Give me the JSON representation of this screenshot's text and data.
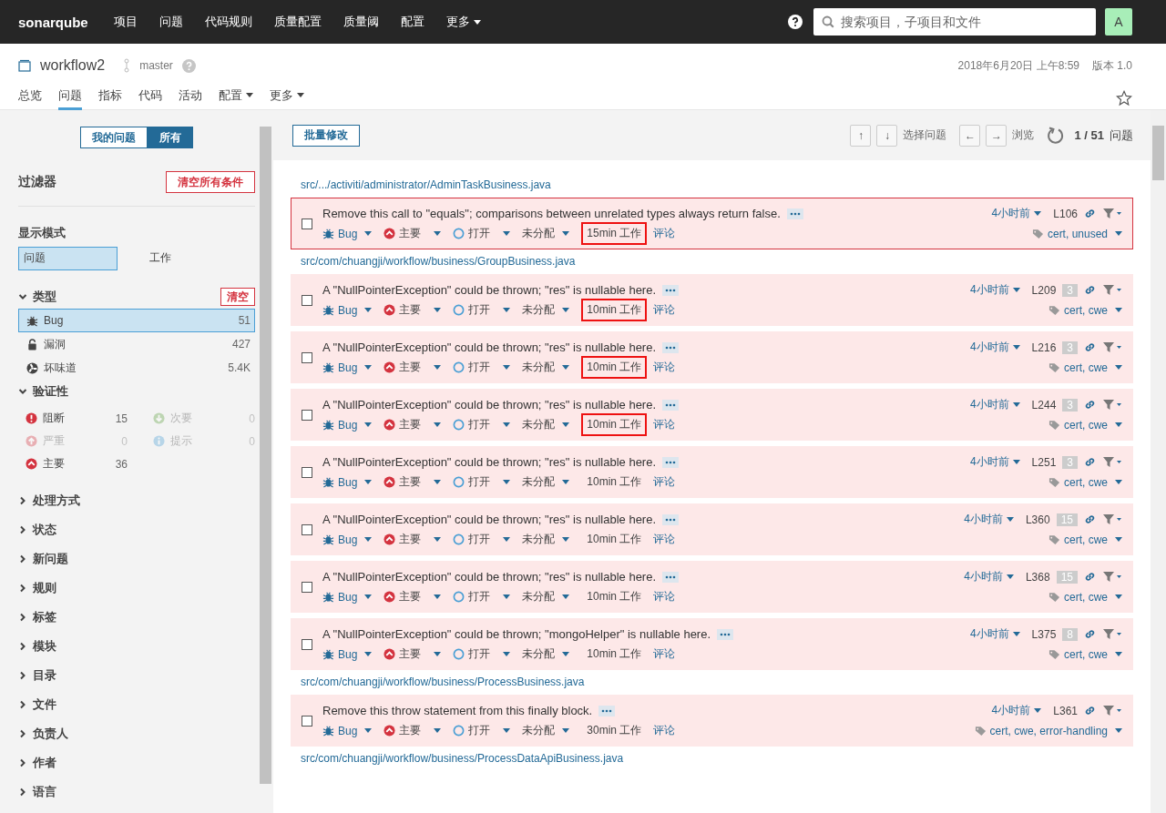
{
  "navbar": {
    "logo": "sonarqube",
    "items": [
      {
        "label": "项目",
        "dropdown": false
      },
      {
        "label": "问题",
        "dropdown": false
      },
      {
        "label": "代码规则",
        "dropdown": false
      },
      {
        "label": "质量配置",
        "dropdown": false
      },
      {
        "label": "质量阈",
        "dropdown": false
      },
      {
        "label": "配置",
        "dropdown": false
      },
      {
        "label": "更多",
        "dropdown": true
      }
    ],
    "search": {
      "placeholder": "搜索项目，子项目和文件"
    },
    "avatar": "A"
  },
  "project": {
    "name": "workflow2",
    "branch": "master",
    "date": "2018年6月20日 上午8:59",
    "version": "版本 1.0",
    "tabs": [
      {
        "label": "总览",
        "selected": false,
        "dropdown": false
      },
      {
        "label": "问题",
        "selected": true,
        "dropdown": false
      },
      {
        "label": "指标",
        "selected": false,
        "dropdown": false
      },
      {
        "label": "代码",
        "selected": false,
        "dropdown": false
      },
      {
        "label": "活动",
        "selected": false,
        "dropdown": false
      },
      {
        "label": "配置",
        "selected": false,
        "dropdown": true
      },
      {
        "label": "更多",
        "selected": false,
        "dropdown": true
      }
    ]
  },
  "sidebar": {
    "scope": [
      {
        "label": "我的问题",
        "selected": false
      },
      {
        "label": "所有",
        "selected": true
      }
    ],
    "filters_title": "过滤器",
    "clear_all": "清空所有条件",
    "mode_title": "显示模式",
    "modes": [
      {
        "label": "问题",
        "selected": true
      },
      {
        "label": "工作",
        "selected": false
      }
    ],
    "type_facet": {
      "title": "类型",
      "expanded": true,
      "clear": "清空",
      "items": [
        {
          "kind": "bug",
          "label": "Bug",
          "count": "51",
          "selected": true
        },
        {
          "kind": "vulnerability",
          "label": "漏洞",
          "count": "427",
          "selected": false
        },
        {
          "kind": "code_smell",
          "label": "坏味道",
          "count": "5.4K",
          "selected": false
        }
      ]
    },
    "severity_facet": {
      "title": "验证性",
      "expanded": true,
      "items": [
        {
          "kind": "blocker",
          "label": "阻断",
          "count": "15",
          "disabled": false
        },
        {
          "kind": "minor",
          "label": "次要",
          "count": "0",
          "disabled": true
        },
        {
          "kind": "critical",
          "label": "严重",
          "count": "0",
          "disabled": true
        },
        {
          "kind": "info",
          "label": "提示",
          "count": "0",
          "disabled": true
        },
        {
          "kind": "major",
          "label": "主要",
          "count": "36",
          "disabled": false
        }
      ]
    },
    "facets": [
      {
        "title": "处理方式",
        "expanded": false
      },
      {
        "title": "状态",
        "expanded": false
      },
      {
        "title": "新问题",
        "expanded": false
      },
      {
        "title": "规则",
        "expanded": false
      },
      {
        "title": "标签",
        "expanded": false
      },
      {
        "title": "模块",
        "expanded": false
      },
      {
        "title": "目录",
        "expanded": false
      },
      {
        "title": "文件",
        "expanded": false
      },
      {
        "title": "负责人",
        "expanded": false
      },
      {
        "title": "作者",
        "expanded": false
      },
      {
        "title": "语言",
        "expanded": false
      }
    ]
  },
  "toolbar": {
    "bulk_change": "批量修改",
    "select_label": "选择问题",
    "browse_label": "浏览",
    "up_key": "↑",
    "down_key": "↓",
    "left_key": "←",
    "right_key": "→",
    "count": "1 / 51",
    "count_unit": "问题"
  },
  "groups": [
    {
      "path": "src/.../activiti/administrator/AdminTaskBusiness.java",
      "issues": [
        {
          "message": "Remove this call to \"equals\"; comparisons between unrelated types always return false.",
          "selected": true,
          "type": "Bug",
          "severity": "主要",
          "status": "打开",
          "assignee": "未分配",
          "effort": "15min 工作",
          "effort_highlighted": true,
          "comment": "评论",
          "time": "4小时前",
          "line": "L106",
          "tags": "cert, unused"
        }
      ]
    },
    {
      "path": "src/com/chuangji/workflow/business/GroupBusiness.java",
      "issues": [
        {
          "message": "A \"NullPointerException\" could be thrown; \"res\" is nullable here.",
          "selected": false,
          "type": "Bug",
          "severity": "主要",
          "status": "打开",
          "assignee": "未分配",
          "effort": "10min 工作",
          "effort_highlighted": true,
          "comment": "评论",
          "time": "4小时前",
          "line": "L209",
          "locations": "3",
          "tags": "cert, cwe"
        },
        {
          "message": "A \"NullPointerException\" could be thrown; \"res\" is nullable here.",
          "selected": false,
          "type": "Bug",
          "severity": "主要",
          "status": "打开",
          "assignee": "未分配",
          "effort": "10min 工作",
          "effort_highlighted": true,
          "comment": "评论",
          "time": "4小时前",
          "line": "L216",
          "locations": "3",
          "tags": "cert, cwe"
        },
        {
          "message": "A \"NullPointerException\" could be thrown; \"res\" is nullable here.",
          "selected": false,
          "type": "Bug",
          "severity": "主要",
          "status": "打开",
          "assignee": "未分配",
          "effort": "10min 工作",
          "effort_highlighted": true,
          "comment": "评论",
          "time": "4小时前",
          "line": "L244",
          "locations": "3",
          "tags": "cert, cwe"
        },
        {
          "message": "A \"NullPointerException\" could be thrown; \"res\" is nullable here.",
          "selected": false,
          "type": "Bug",
          "severity": "主要",
          "status": "打开",
          "assignee": "未分配",
          "effort": "10min 工作",
          "effort_highlighted": false,
          "comment": "评论",
          "time": "4小时前",
          "line": "L251",
          "locations": "3",
          "tags": "cert, cwe"
        },
        {
          "message": "A \"NullPointerException\" could be thrown; \"res\" is nullable here.",
          "selected": false,
          "type": "Bug",
          "severity": "主要",
          "status": "打开",
          "assignee": "未分配",
          "effort": "10min 工作",
          "effort_highlighted": false,
          "comment": "评论",
          "time": "4小时前",
          "line": "L360",
          "locations": "15",
          "tags": "cert, cwe"
        },
        {
          "message": "A \"NullPointerException\" could be thrown; \"res\" is nullable here.",
          "selected": false,
          "type": "Bug",
          "severity": "主要",
          "status": "打开",
          "assignee": "未分配",
          "effort": "10min 工作",
          "effort_highlighted": false,
          "comment": "评论",
          "time": "4小时前",
          "line": "L368",
          "locations": "15",
          "tags": "cert, cwe"
        },
        {
          "message": "A \"NullPointerException\" could be thrown; \"mongoHelper\" is nullable here.",
          "selected": false,
          "type": "Bug",
          "severity": "主要",
          "status": "打开",
          "assignee": "未分配",
          "effort": "10min 工作",
          "effort_highlighted": false,
          "comment": "评论",
          "time": "4小时前",
          "line": "L375",
          "locations": "8",
          "tags": "cert, cwe"
        }
      ]
    },
    {
      "path": "src/com/chuangji/workflow/business/ProcessBusiness.java",
      "issues": [
        {
          "message": "Remove this throw statement from this finally block.",
          "selected": false,
          "type": "Bug",
          "severity": "主要",
          "status": "打开",
          "assignee": "未分配",
          "effort": "30min 工作",
          "effort_highlighted": false,
          "comment": "评论",
          "time": "4小时前",
          "line": "L361",
          "tags": "cert, cwe, error-handling"
        }
      ]
    },
    {
      "path": "src/com/chuangji/workflow/business/ProcessDataApiBusiness.java"
    }
  ]
}
